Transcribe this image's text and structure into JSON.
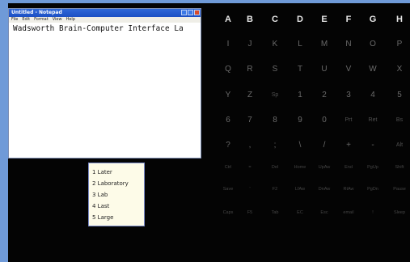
{
  "notepad": {
    "title": "Untitled - Notepad",
    "menu": [
      "File",
      "Edit",
      "Format",
      "View",
      "Help"
    ],
    "text": "Wadsworth Brain-Computer Interface La"
  },
  "predictions": [
    "1 Later",
    "2 Laboratory",
    "3 Lab",
    "4 Last",
    "5 Large"
  ],
  "keyboard": {
    "rows": [
      [
        "A",
        "B",
        "C",
        "D",
        "E",
        "F",
        "G",
        "H"
      ],
      [
        "I",
        "J",
        "K",
        "L",
        "M",
        "N",
        "O",
        "P"
      ],
      [
        "Q",
        "R",
        "S",
        "T",
        "U",
        "V",
        "W",
        "X"
      ],
      [
        "Y",
        "Z",
        "Sp",
        "1",
        "2",
        "3",
        "4",
        "5"
      ],
      [
        "6",
        "7",
        "8",
        "9",
        "0",
        "Prt",
        "Ret",
        "Bs"
      ],
      [
        "?",
        ",",
        ";",
        "\\",
        "/",
        "+",
        "-",
        "Alt"
      ],
      [
        "Ctrl",
        "=",
        "Del",
        "Home",
        "UpAw",
        "End",
        "PgUp",
        "Shift"
      ],
      [
        "Save",
        "'",
        "F2",
        "LfAw",
        "DnAw",
        "RtAw",
        "PgDn",
        "Pause"
      ],
      [
        "Caps",
        "F5",
        "Tab",
        "EC",
        "Esc",
        "email",
        "!",
        "Sleep"
      ]
    ]
  }
}
